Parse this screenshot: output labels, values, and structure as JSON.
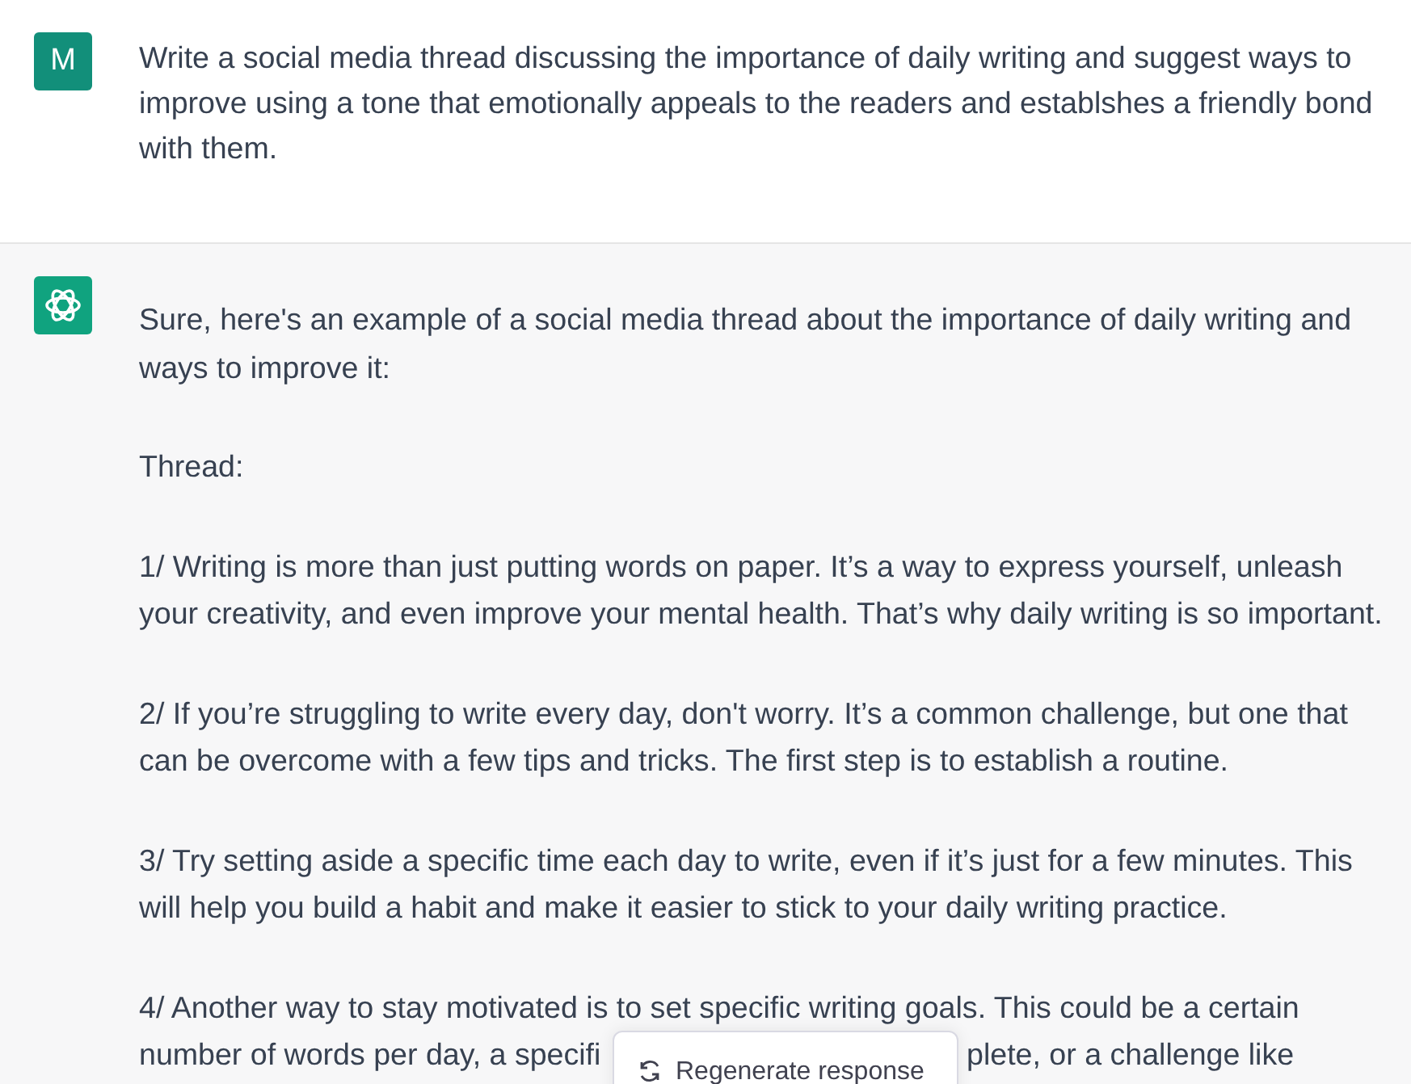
{
  "user_message": {
    "avatar_letter": "M",
    "text": "Write a social media thread discussing the importance of daily writing and suggest ways to improve using a tone that emotionally appeals to the readers and establshes a friendly bond with them."
  },
  "assistant_message": {
    "paragraphs": [
      {
        "kind": "text",
        "text": "Sure, here's an example of a social media thread about the importance of daily writing and ways to improve it:"
      },
      {
        "kind": "text",
        "text": "Thread:"
      },
      {
        "kind": "text",
        "text": "1/ Writing is more than just putting words on paper. It’s a way to express yourself, unleash your creativity, and even improve your mental health. That’s why daily writing is so important."
      },
      {
        "kind": "text",
        "text": "2/ If you’re struggling to write every day, don't worry. It’s a common challenge, but one that can be overcome with a few tips and tricks. The first step is to establish a routine."
      },
      {
        "kind": "text",
        "text": "3/ Try setting aside a specific time each day to write, even if it’s just for a few minutes. This will help you build a habit and make it easier to stick to your daily writing practice."
      },
      {
        "kind": "covered",
        "lines": [
          "4/ Another way to stay motivated is to set specific writing goals. This could be a certain"
        ],
        "before_cover": "number of words per day, a specifi",
        "after_cover": "plete, or a challenge like"
      }
    ]
  },
  "regenerate_button": {
    "label": "Regenerate response"
  }
}
